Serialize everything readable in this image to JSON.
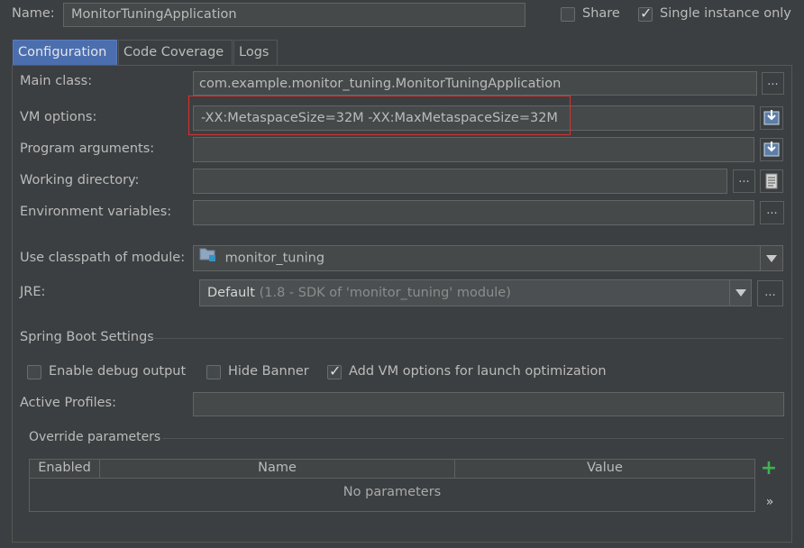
{
  "header": {
    "name_label": "Name:",
    "name_value": "MonitorTuningApplication",
    "share_label": "Share",
    "share_checked": false,
    "single_instance_label": "Single instance only",
    "single_instance_checked": true
  },
  "tabs": [
    {
      "label": "Configuration",
      "selected": true
    },
    {
      "label": "Code Coverage",
      "selected": false
    },
    {
      "label": "Logs",
      "selected": false
    }
  ],
  "form": {
    "main_class_label": "Main class:",
    "main_class_value": "com.example.monitor_tuning.MonitorTuningApplication",
    "vm_options_label": "VM options:",
    "vm_options_value": "-XX:MetaspaceSize=32M -XX:MaxMetaspaceSize=32M",
    "program_args_label": "Program arguments:",
    "program_args_value": "",
    "working_dir_label": "Working directory:",
    "working_dir_value": "",
    "env_vars_label": "Environment variables:",
    "env_vars_value": "",
    "classpath_label": "Use classpath of module:",
    "classpath_value": "monitor_tuning",
    "jre_label": "JRE:",
    "jre_value": "Default",
    "jre_detail": "(1.8 - SDK of 'monitor_tuning' module)",
    "browse_button": "..."
  },
  "spring_boot": {
    "section_title": "Spring Boot Settings",
    "enable_debug_label": "Enable debug output",
    "enable_debug_checked": false,
    "hide_banner_label": "Hide Banner",
    "hide_banner_checked": false,
    "add_vm_label": "Add VM options for launch optimization",
    "add_vm_checked": true,
    "active_profiles_label": "Active Profiles:",
    "active_profiles_value": ""
  },
  "override": {
    "section_title": "Override parameters",
    "columns": [
      "Enabled",
      "Name",
      "Value"
    ],
    "empty_text": "No parameters",
    "add_icon": "+",
    "expand_icon": "»"
  },
  "colors": {
    "highlight_box": "#d9322f",
    "selected_tab": "#4b6eaf",
    "add_icon": "#3fb34f"
  }
}
